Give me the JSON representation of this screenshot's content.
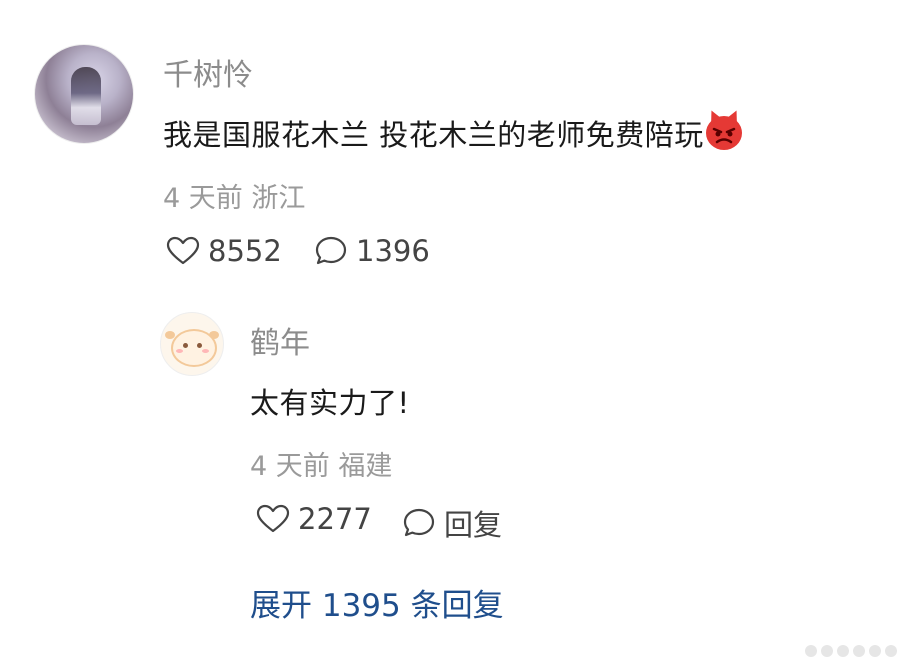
{
  "comment": {
    "author": "千树怜",
    "text": "我是国服花木兰 投花木兰的老师免费陪玩",
    "emoji": "angry-devil-emoji",
    "time_location": "4 天前 浙江",
    "likes": "8552",
    "replies": "1396"
  },
  "reply": {
    "author": "鹤年",
    "text": "太有实力了!",
    "time_location": "4 天前 福建",
    "likes": "2277",
    "reply_label": "回复"
  },
  "expand": {
    "label": "展开 1395 条回复"
  },
  "colors": {
    "link": "#1f4e8c",
    "meta": "#9a9a9a",
    "name": "#8c8c8c"
  }
}
